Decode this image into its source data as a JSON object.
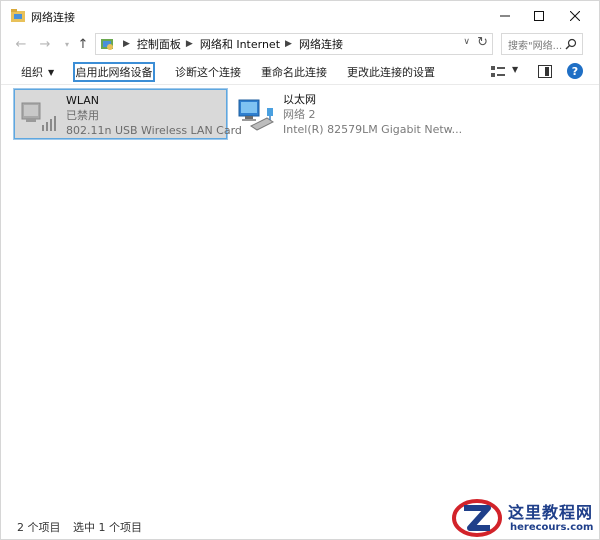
{
  "window": {
    "title": "网络连接",
    "minimize_label": "—",
    "maximize_label": "☐",
    "close_label": "✕"
  },
  "nav": {
    "back_label": "←",
    "forward_label": "→",
    "history_label": "▾",
    "up_label": "↑"
  },
  "address": {
    "breadcrumbs": [
      "控制面板",
      "网络和 Internet",
      "网络连接"
    ],
    "dropdown_label": "∨",
    "refresh_label": "↻"
  },
  "search": {
    "placeholder": "搜索\"网络...",
    "value": ""
  },
  "commands": {
    "organize": "组织",
    "organize_caret": "▼",
    "enable_device": "启用此网络设备",
    "diagnose": "诊断这个连接",
    "rename": "重命名此连接",
    "change_settings": "更改此连接的设置",
    "view_caret": "▼",
    "help_label": "?"
  },
  "connections": [
    {
      "name": "WLAN",
      "status": "已禁用",
      "device": "802.11n USB Wireless LAN Card",
      "selected": true
    },
    {
      "name": "以太网",
      "status": "网络 2",
      "device": "Intel(R) 82579LM Gigabit Netw...",
      "selected": false
    }
  ],
  "statusbar": {
    "count": "2 个项目",
    "selected": "选中 1 个项目"
  },
  "watermark": {
    "name": "这里教程网",
    "url": "herecours.com"
  },
  "colors": {
    "accent": "#3c8ed6",
    "selection_bg": "#d9d9d9",
    "help_blue": "#1f6fc5",
    "watermark_blue": "#1f3f8a",
    "watermark_red": "#d2232a"
  }
}
